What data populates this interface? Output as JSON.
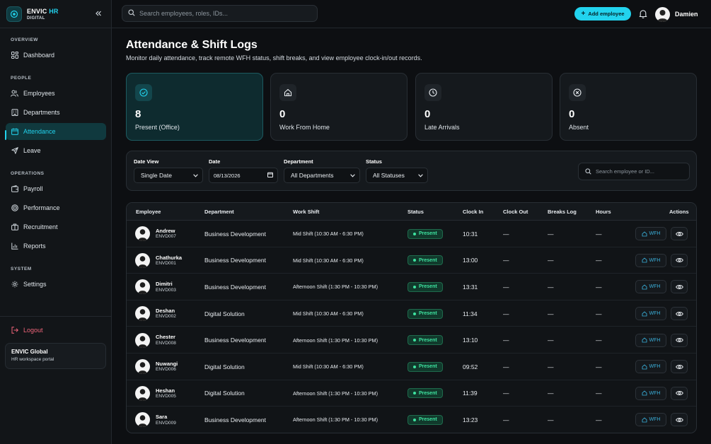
{
  "brand": {
    "name_main": "ENVIC",
    "name_accent": "HR",
    "sub": "DIGITAL"
  },
  "sidebar": {
    "sections": [
      {
        "label": "OVERVIEW",
        "items": [
          {
            "label": "Dashboard",
            "icon": "grid-icon"
          }
        ]
      },
      {
        "label": "PEOPLE",
        "items": [
          {
            "label": "Employees",
            "icon": "users-icon"
          },
          {
            "label": "Departments",
            "icon": "building-icon"
          },
          {
            "label": "Attendance",
            "icon": "calendar-icon",
            "active": true
          },
          {
            "label": "Leave",
            "icon": "plane-icon"
          }
        ]
      },
      {
        "label": "OPERATIONS",
        "items": [
          {
            "label": "Payroll",
            "icon": "wallet-icon"
          },
          {
            "label": "Performance",
            "icon": "target-icon"
          },
          {
            "label": "Recruitment",
            "icon": "briefcase-icon"
          },
          {
            "label": "Reports",
            "icon": "chart-icon"
          }
        ]
      },
      {
        "label": "SYSTEM",
        "items": [
          {
            "label": "Settings",
            "icon": "gear-icon"
          }
        ]
      }
    ],
    "logout": "Logout",
    "org": {
      "name": "ENVIC Global",
      "sub": "HR workspace portal"
    }
  },
  "topbar": {
    "search_placeholder": "Search employees, roles, IDs...",
    "add_button": "Add employee",
    "user_name": "Damien"
  },
  "page": {
    "title": "Attendance & Shift Logs",
    "subtitle": "Monitor daily attendance, track remote WFH status, shift breaks, and view employee clock-in/out records."
  },
  "stats": [
    {
      "value": "8",
      "label": "Present (Office)",
      "icon": "check-circle-icon",
      "active": true
    },
    {
      "value": "0",
      "label": "Work From Home",
      "icon": "home-icon"
    },
    {
      "value": "0",
      "label": "Late Arrivals",
      "icon": "clock-icon"
    },
    {
      "value": "0",
      "label": "Absent",
      "icon": "x-circle-icon"
    }
  ],
  "filters": {
    "date_view": {
      "label": "Date View",
      "value": "Single Date"
    },
    "date": {
      "label": "Date",
      "value": "08/13/2026"
    },
    "department": {
      "label": "Department",
      "value": "All Departments"
    },
    "status": {
      "label": "Status",
      "value": "All Statuses"
    },
    "search_placeholder": "Search employee or ID..."
  },
  "table": {
    "headers": [
      "Employee",
      "Department",
      "Work Shift",
      "Status",
      "Clock In",
      "Clock Out",
      "Breaks Log",
      "Hours",
      "Actions"
    ],
    "wfh_label": "WFH",
    "rows": [
      {
        "name": "Andrew",
        "id": "ENVD007",
        "dept": "Business Development",
        "shift": "Mid Shift (10:30 AM - 6:30 PM)",
        "status": "Present",
        "clock_in": "10:31",
        "clock_out": "—",
        "breaks": "—",
        "hours": "—"
      },
      {
        "name": "Chathurka",
        "id": "ENVD001",
        "dept": "Business Development",
        "shift": "Mid Shift (10:30 AM - 6:30 PM)",
        "status": "Present",
        "clock_in": "13:00",
        "clock_out": "—",
        "breaks": "—",
        "hours": "—",
        "avatar_alt": "Chath"
      },
      {
        "name": "Dimitri",
        "id": "ENVD003",
        "dept": "Business Development",
        "shift": "Afternoon Shift (1:30 PM - 10:30 PM)",
        "status": "Present",
        "clock_in": "13:31",
        "clock_out": "—",
        "breaks": "—",
        "hours": "—"
      },
      {
        "name": "Deshan",
        "id": "ENVD002",
        "dept": "Digital Solution",
        "shift": "Mid Shift (10:30 AM - 6:30 PM)",
        "status": "Present",
        "clock_in": "11:34",
        "clock_out": "—",
        "breaks": "—",
        "hours": "—"
      },
      {
        "name": "Chester",
        "id": "ENVD008",
        "dept": "Business Development",
        "shift": "Afternoon Shift (1:30 PM - 10:30 PM)",
        "status": "Present",
        "clock_in": "13:10",
        "clock_out": "—",
        "breaks": "—",
        "hours": "—"
      },
      {
        "name": "Nuwangi",
        "id": "ENVD006",
        "dept": "Digital Solution",
        "shift": "Mid Shift (10:30 AM - 6:30 PM)",
        "status": "Present",
        "clock_in": "09:52",
        "clock_out": "—",
        "breaks": "—",
        "hours": "—"
      },
      {
        "name": "Heshan",
        "id": "ENVD005",
        "dept": "Digital Solution",
        "shift": "Afternoon Shift (1:30 PM - 10:30 PM)",
        "status": "Present",
        "clock_in": "11:39",
        "clock_out": "—",
        "breaks": "—",
        "hours": "—"
      },
      {
        "name": "Sara",
        "id": "ENVD009",
        "dept": "Business Development",
        "shift": "Afternoon Shift (1:30 PM - 10:30 PM)",
        "status": "Present",
        "clock_in": "13:23",
        "clock_out": "—",
        "breaks": "—",
        "hours": "—"
      }
    ]
  },
  "colors": {
    "accent": "#22d3ee",
    "present": "#3ee3a0",
    "logout": "#f0657a",
    "background": "#0d0f12"
  }
}
